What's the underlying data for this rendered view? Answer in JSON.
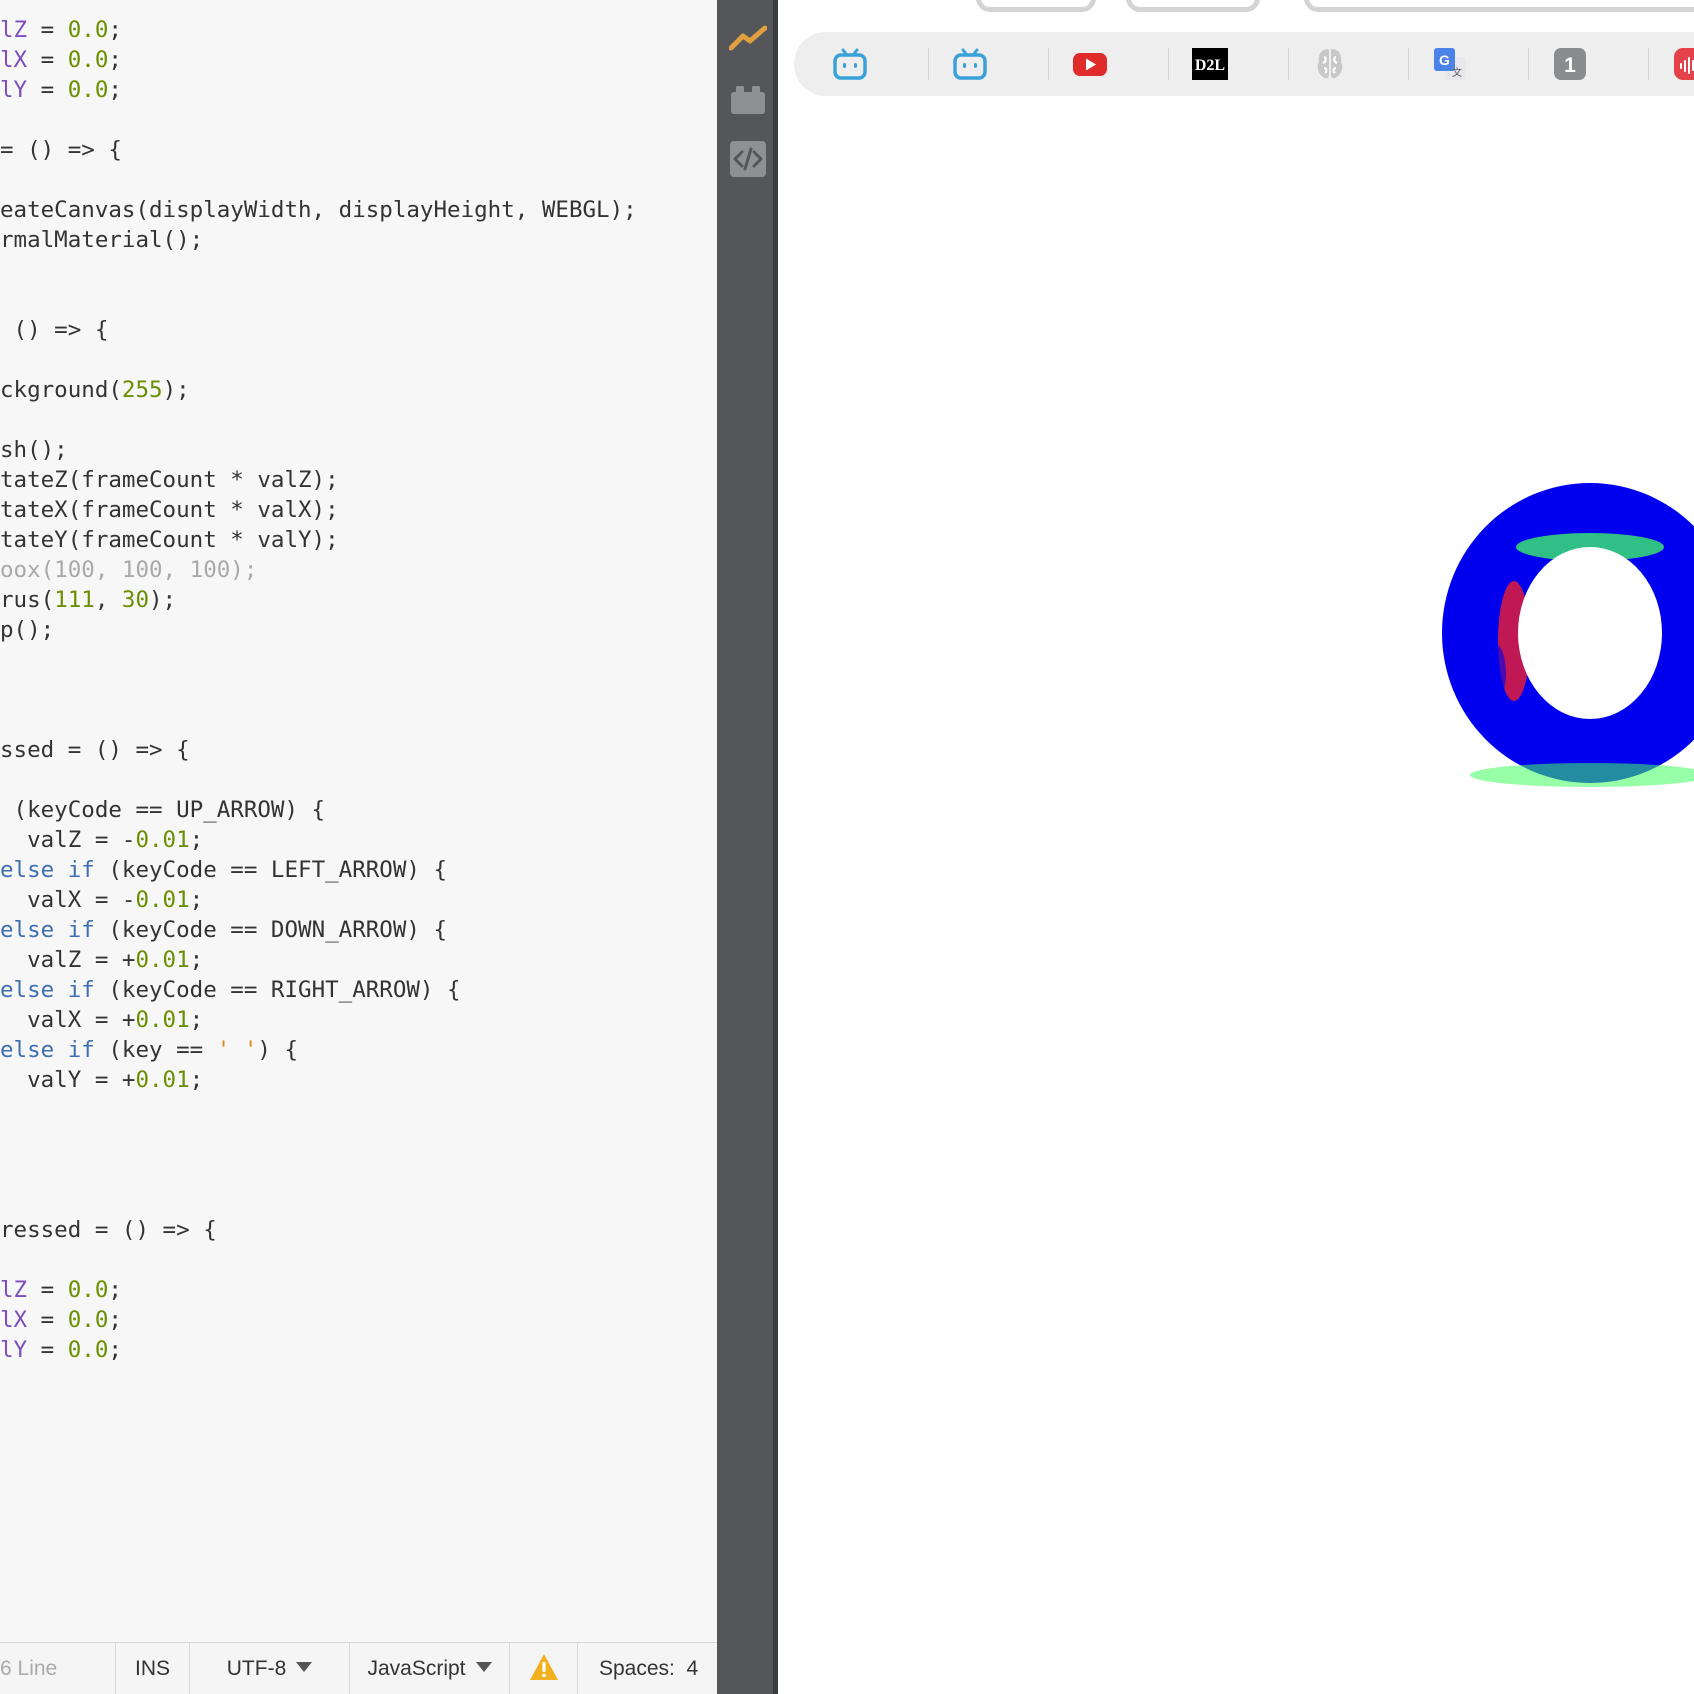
{
  "editor": {
    "code_lines": [
      [
        [
          "lZ",
          "t-var"
        ],
        [
          " = ",
          ""
        ],
        [
          "0.0",
          "t-num"
        ],
        [
          ";",
          ""
        ]
      ],
      [
        [
          "lX",
          "t-var"
        ],
        [
          " = ",
          ""
        ],
        [
          "0.0",
          "t-num"
        ],
        [
          ";",
          ""
        ]
      ],
      [
        [
          "lY",
          "t-var"
        ],
        [
          " = ",
          ""
        ],
        [
          "0.0",
          "t-num"
        ],
        [
          ";",
          ""
        ]
      ],
      [],
      [
        [
          "= () => {",
          ""
        ]
      ],
      [],
      [
        [
          "eateCanvas(displayWidth, displayHeight, WEBGL);",
          ""
        ]
      ],
      [
        [
          "rmalMaterial();",
          ""
        ]
      ],
      [],
      [],
      [
        [
          " () => {",
          ""
        ]
      ],
      [],
      [
        [
          "ckground(",
          ""
        ],
        [
          "255",
          "t-num"
        ],
        [
          ");",
          ""
        ]
      ],
      [],
      [
        [
          "sh();",
          ""
        ]
      ],
      [
        [
          "tateZ(frameCount * valZ);",
          ""
        ]
      ],
      [
        [
          "tateX(frameCount * valX);",
          ""
        ]
      ],
      [
        [
          "tateY(frameCount * valY);",
          ""
        ]
      ],
      [
        [
          "oox(100, 100, 100);",
          "t-com"
        ]
      ],
      [
        [
          "rus(",
          ""
        ],
        [
          "111",
          "t-num"
        ],
        [
          ", ",
          ""
        ],
        [
          "30",
          "t-num"
        ],
        [
          ");",
          ""
        ]
      ],
      [
        [
          "p();",
          ""
        ]
      ],
      [],
      [],
      [],
      [
        [
          "ssed = () => {",
          ""
        ]
      ],
      [],
      [
        [
          " (keyCode == UP_ARROW) {",
          ""
        ]
      ],
      [
        [
          "  valZ = -",
          ""
        ],
        [
          "0.01",
          "t-num"
        ],
        [
          ";",
          ""
        ]
      ],
      [
        [
          "else",
          "t-kw"
        ],
        [
          " ",
          ""
        ],
        [
          "if",
          "t-kw"
        ],
        [
          " (keyCode == LEFT_ARROW) {",
          ""
        ]
      ],
      [
        [
          "  valX = -",
          ""
        ],
        [
          "0.01",
          "t-num"
        ],
        [
          ";",
          ""
        ]
      ],
      [
        [
          "else",
          "t-kw"
        ],
        [
          " ",
          ""
        ],
        [
          "if",
          "t-kw"
        ],
        [
          " (keyCode == DOWN_ARROW) {",
          ""
        ]
      ],
      [
        [
          "  valZ = +",
          ""
        ],
        [
          "0.01",
          "t-num"
        ],
        [
          ";",
          ""
        ]
      ],
      [
        [
          "else",
          "t-kw"
        ],
        [
          " ",
          ""
        ],
        [
          "if",
          "t-kw"
        ],
        [
          " (keyCode == RIGHT_ARROW) {",
          ""
        ]
      ],
      [
        [
          "  valX = +",
          ""
        ],
        [
          "0.01",
          "t-num"
        ],
        [
          ";",
          ""
        ]
      ],
      [
        [
          "else",
          "t-kw"
        ],
        [
          " ",
          ""
        ],
        [
          "if",
          "t-kw"
        ],
        [
          " (key == ",
          ""
        ],
        [
          "' '",
          "t-str"
        ],
        [
          ") {",
          ""
        ]
      ],
      [
        [
          "  valY = +",
          ""
        ],
        [
          "0.01",
          "t-num"
        ],
        [
          ";",
          ""
        ]
      ],
      [],
      [],
      [],
      [],
      [
        [
          "ressed = () => {",
          ""
        ]
      ],
      [],
      [
        [
          "lZ",
          "t-var"
        ],
        [
          " = ",
          ""
        ],
        [
          "0.0",
          "t-num"
        ],
        [
          ";",
          ""
        ]
      ],
      [
        [
          "lX",
          "t-var"
        ],
        [
          " = ",
          ""
        ],
        [
          "0.0",
          "t-num"
        ],
        [
          ";",
          ""
        ]
      ],
      [
        [
          "lY",
          "t-var"
        ],
        [
          " = ",
          ""
        ],
        [
          "0.0",
          "t-num"
        ],
        [
          ";",
          ""
        ]
      ]
    ],
    "status": {
      "line_info": "6 Line",
      "insert_mode": "INS",
      "encoding": "UTF-8",
      "language": "JavaScript",
      "warning_icon": "warning-icon",
      "indentation": "Spaces:  4"
    }
  },
  "sidebar": {
    "tools": [
      "activity-icon",
      "plugin-icon",
      "code-icon"
    ],
    "accent_color": "#e0a040"
  },
  "browser": {
    "bookmarks": [
      {
        "name": "bilibili-icon",
        "color": "#3aa0d8"
      },
      {
        "name": "bilibili-icon",
        "color": "#3aa0d8"
      },
      {
        "name": "youtube-icon",
        "color": "#e02b2b",
        "play_color": "#ffffff"
      },
      {
        "name": "d2l-icon",
        "label": "D2L",
        "color": "#000000"
      },
      {
        "name": "brain-icon",
        "color": "#c8c8c8"
      },
      {
        "name": "google-translate-icon",
        "color": "#4a82e8"
      },
      {
        "name": "onepassword-icon",
        "label": "1",
        "color": "#8a8c90"
      },
      {
        "name": "podcast-icon",
        "color": "#e4424a"
      }
    ]
  },
  "sketch": {
    "shape": "torus",
    "outer_color": "#0000ee",
    "highlight_red": "#ff2020",
    "highlight_green": "#40ff60"
  }
}
